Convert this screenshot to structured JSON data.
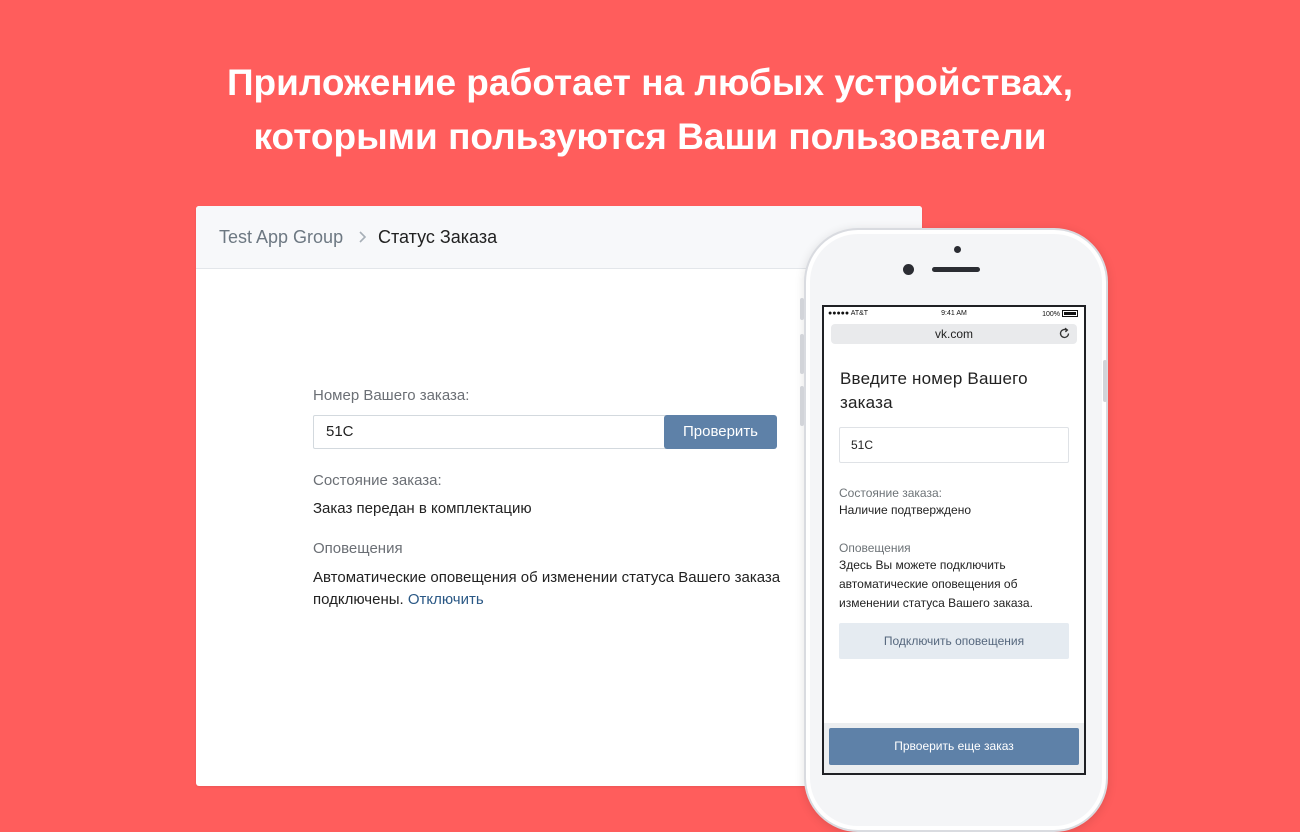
{
  "headline": {
    "line1": "Приложение работает на любых устройствах,",
    "line2": "которыми пользуются Ваши пользователи"
  },
  "colors": {
    "background": "#ff5d5c",
    "accent": "#5e81a8",
    "link": "#2a5885"
  },
  "desktop": {
    "breadcrumb": {
      "group": "Test App Group",
      "separator_icon": "chevron-right-icon",
      "page": "Статус Заказа"
    },
    "order_label": "Номер Вашего заказа:",
    "order_value": "51С",
    "check_button": "Проверить",
    "status_label": "Состояние заказа:",
    "status_value": "Заказ передан в комплектацию",
    "notify_label": "Оповещения",
    "notify_text_line1": "Автоматические оповещения об изменении статуса Вашего заказа",
    "notify_text_line2": "подключены.",
    "notify_link": "Отключить"
  },
  "mobile": {
    "statusbar": {
      "carrier": "●●●●● AT&T",
      "time": "9:41 AM",
      "battery": "100%"
    },
    "url": "vk.com",
    "title": "Введите номер Вашего заказа",
    "order_value": "51С",
    "status_label": "Состояние заказа:",
    "status_value": "Наличие подтверждено",
    "notify_label": "Оповещения",
    "notify_text": "Здесь Вы можете подключить автоматические оповещения об изменении статуса Вашего заказа.",
    "subscribe_button": "Подключить оповещения",
    "check_again_button": "Првоерить еще заказ"
  }
}
